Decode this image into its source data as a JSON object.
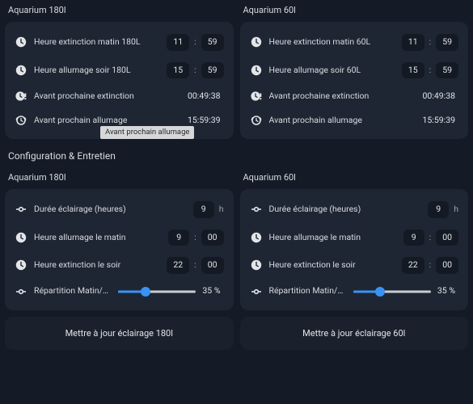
{
  "status": {
    "left": {
      "title": "Aquarium 180l",
      "rows": [
        {
          "icon": "clock",
          "label": "Heure extinction matin 180L",
          "type": "time",
          "h": "11",
          "m": "59"
        },
        {
          "icon": "clock",
          "label": "Heure allumage soir 180L",
          "type": "time",
          "h": "15",
          "m": "59"
        },
        {
          "icon": "clock-alert",
          "label": "Avant prochaine extinction",
          "type": "plain",
          "value": "00:49:38"
        },
        {
          "icon": "clock-ring",
          "label": "Avant prochain allumage",
          "type": "plain",
          "value": "15:59:39",
          "tooltip": "Avant prochain allumage"
        }
      ]
    },
    "right": {
      "title": "Aquarium 60l",
      "rows": [
        {
          "icon": "clock",
          "label": "Heure extinction matin 60L",
          "type": "time",
          "h": "11",
          "m": "59"
        },
        {
          "icon": "clock",
          "label": "Heure allumage soir 60L",
          "type": "time",
          "h": "15",
          "m": "59"
        },
        {
          "icon": "clock-alert",
          "label": "Avant prochaine extinction",
          "type": "plain",
          "value": "00:49:38"
        },
        {
          "icon": "clock-ring",
          "label": "Avant prochain allumage",
          "type": "plain",
          "value": "15:59:39"
        }
      ]
    }
  },
  "config_header": "Configuration & Entretien",
  "config": {
    "left": {
      "title": "Aquarium 180l",
      "rows": [
        {
          "icon": "dash",
          "label": "Durée éclairage (heures)",
          "type": "num-unit",
          "num": "9",
          "unit": "h"
        },
        {
          "icon": "clock",
          "label": "Heure allumage le matin",
          "type": "time",
          "h": "9",
          "m": "00"
        },
        {
          "icon": "clock",
          "label": "Heure extinction le soir",
          "type": "time",
          "h": "22",
          "m": "00"
        }
      ],
      "slider": {
        "icon": "dash",
        "label": "Répartition Matin/Soir ...",
        "percent": 35,
        "display": "35 %"
      },
      "button": "Mettre à jour éclairage 180l"
    },
    "right": {
      "title": "Aquarium 60l",
      "rows": [
        {
          "icon": "dash",
          "label": "Durée éclairage (heures)",
          "type": "num-unit",
          "num": "9",
          "unit": "h"
        },
        {
          "icon": "clock",
          "label": "Heure allumage le matin",
          "type": "time",
          "h": "9",
          "m": "00"
        },
        {
          "icon": "clock",
          "label": "Heure extinction le soir",
          "type": "time",
          "h": "22",
          "m": "00"
        }
      ],
      "slider": {
        "icon": "dash",
        "label": "Répartition Matin/Soir ...",
        "percent": 35,
        "display": "35 %"
      },
      "button": "Mettre à jour éclairage 60l"
    }
  }
}
